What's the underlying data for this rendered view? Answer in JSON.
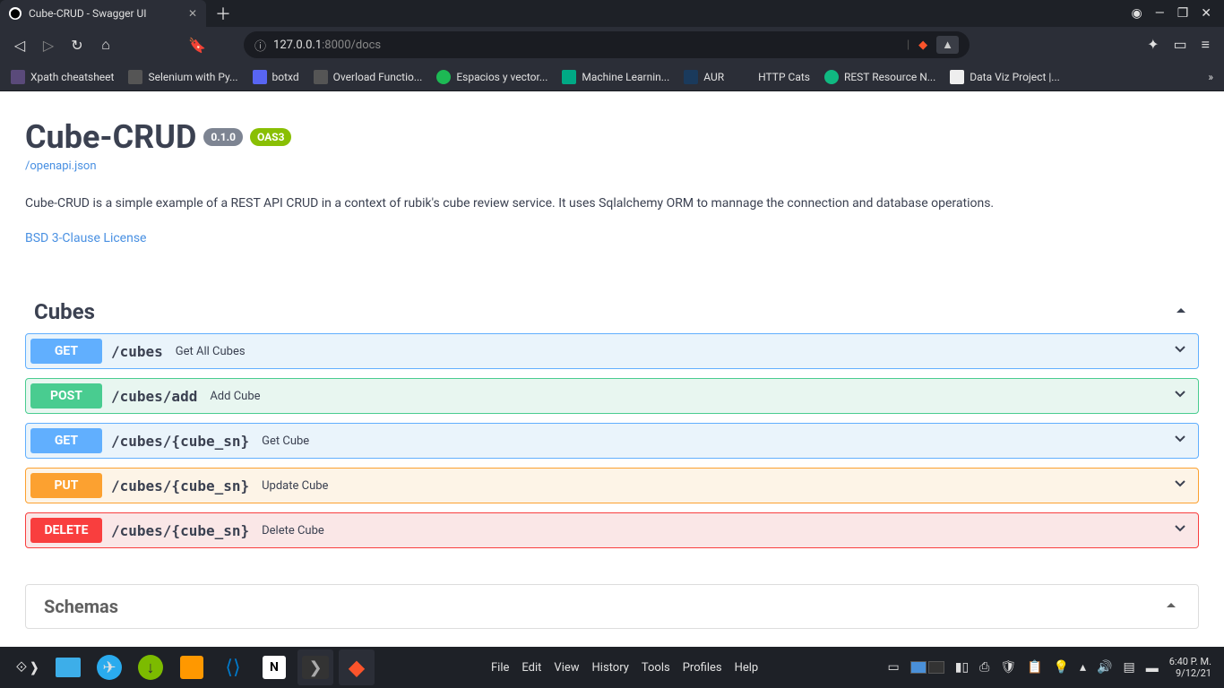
{
  "browser": {
    "tab_title": "Cube-CRUD - Swagger UI",
    "url_host": "127.0.0.1",
    "url_port": ":8000",
    "url_path": "/docs"
  },
  "bookmarks": [
    {
      "label": "Xpath cheatsheet",
      "icon": "bm-purple"
    },
    {
      "label": "Selenium with Py...",
      "icon": "bm-gray"
    },
    {
      "label": "botxd",
      "icon": "bm-blue"
    },
    {
      "label": "Overload Functio...",
      "icon": "bm-gray"
    },
    {
      "label": "Espacios y vector...",
      "icon": "bm-green"
    },
    {
      "label": "Machine Learnin...",
      "icon": "bm-teal"
    },
    {
      "label": "AUR",
      "icon": "bm-darkblue"
    },
    {
      "label": "HTTP Cats",
      "icon": "bm-red"
    },
    {
      "label": "REST Resource N...",
      "icon": "bm-lime"
    },
    {
      "label": "Data Viz Project |...",
      "icon": "bm-white"
    }
  ],
  "api": {
    "title": "Cube-CRUD",
    "version": "0.1.0",
    "oas": "OAS3",
    "openapi_link": "/openapi.json",
    "description": "Cube-CRUD is a simple example of a REST API CRUD in a context of rubik's cube review service. It uses Sqlalchemy ORM to mannage the connection and database operations.",
    "license": "BSD 3-Clause License"
  },
  "section": {
    "name": "Cubes"
  },
  "operations": [
    {
      "method": "GET",
      "method_class": "mb-get",
      "row_class": "op-get",
      "path": "/cubes",
      "summary": "Get All Cubes"
    },
    {
      "method": "POST",
      "method_class": "mb-post",
      "row_class": "op-post",
      "path": "/cubes/add",
      "summary": "Add Cube"
    },
    {
      "method": "GET",
      "method_class": "mb-get",
      "row_class": "op-get",
      "path": "/cubes/{cube_sn}",
      "summary": "Get Cube"
    },
    {
      "method": "PUT",
      "method_class": "mb-put",
      "row_class": "op-put",
      "path": "/cubes/{cube_sn}",
      "summary": "Update Cube"
    },
    {
      "method": "DELETE",
      "method_class": "mb-delete",
      "row_class": "op-delete",
      "path": "/cubes/{cube_sn}",
      "summary": "Delete Cube"
    }
  ],
  "schemas": {
    "title": "Schemas"
  },
  "menubar": [
    "File",
    "Edit",
    "View",
    "History",
    "Tools",
    "Profiles",
    "Help"
  ],
  "clock": {
    "time": "6:40 P. M.",
    "date": "9/12/21"
  }
}
